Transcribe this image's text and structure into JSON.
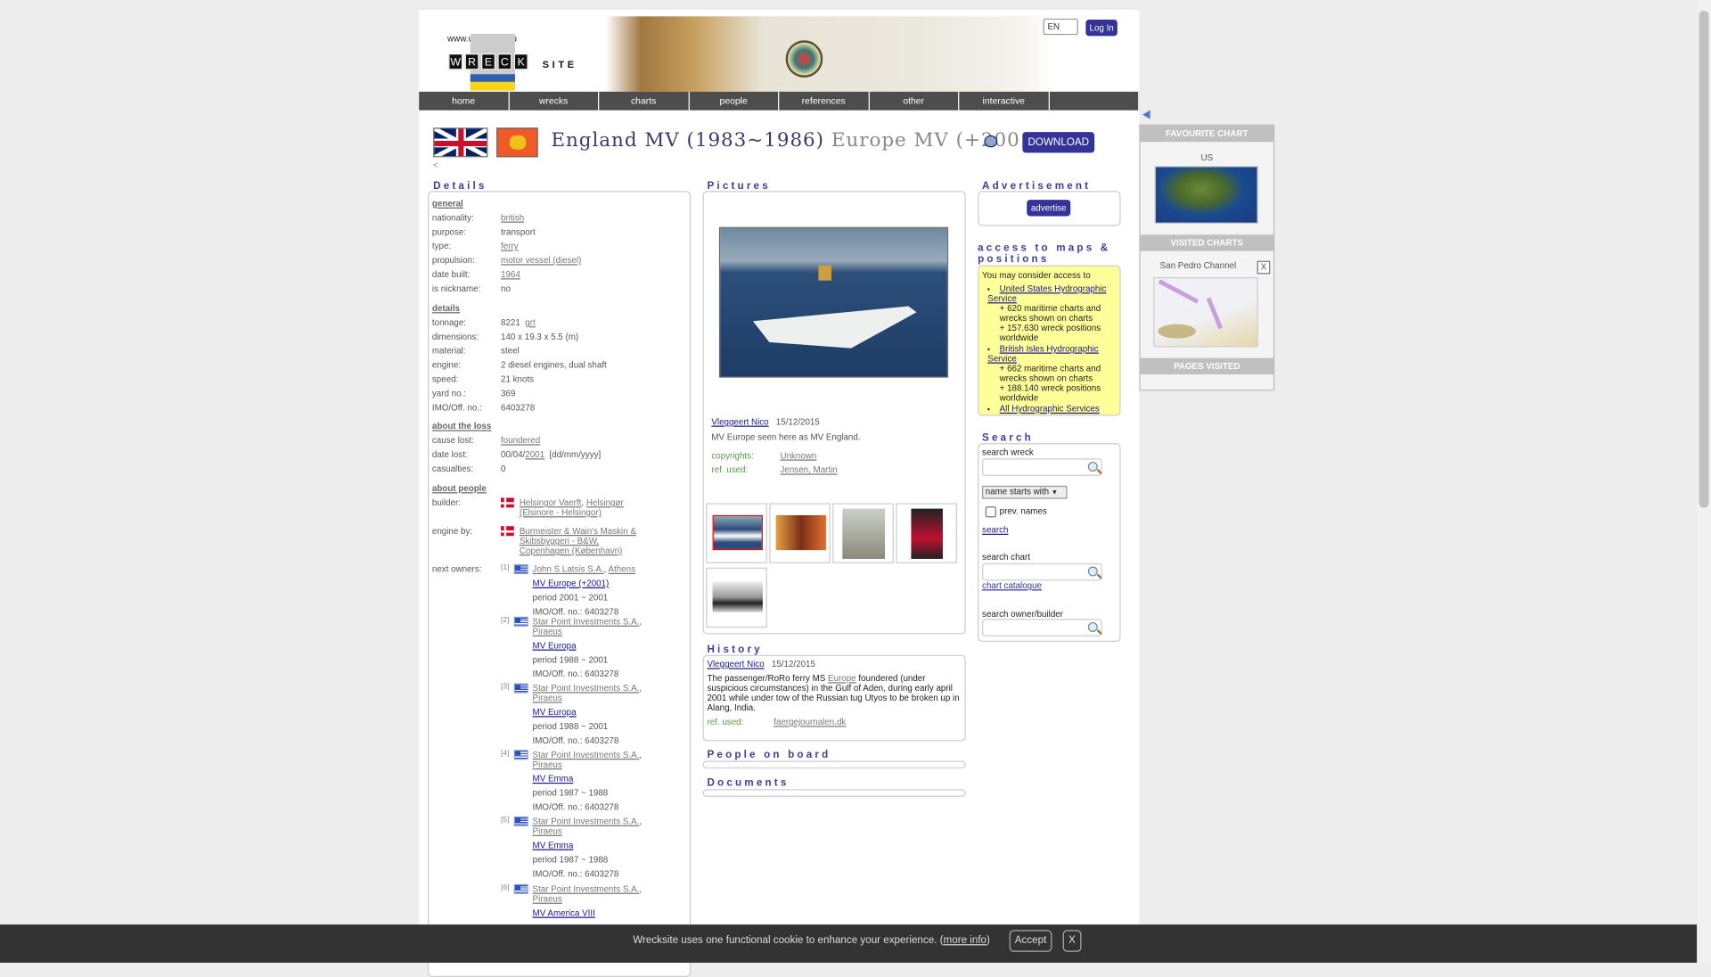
{
  "header": {
    "logo_url_text": "www.wrecksite.eu",
    "logo_letters": [
      "W",
      "R",
      "E",
      "C",
      "K"
    ],
    "logo_site": "SITE",
    "language": "EN",
    "login_label": "Log In"
  },
  "nav": [
    "home",
    "wrecks",
    "charts",
    "people",
    "references",
    "other",
    "interactive",
    ""
  ],
  "title": {
    "main": "England MV (1983~1986)",
    "secondary": "Europe MV (+2001)",
    "download_label": "DOWNLOAD",
    "back": "<"
  },
  "details": {
    "header": "Details",
    "general_label": "general",
    "general": [
      {
        "label": "nationality:",
        "value": "british",
        "link": true
      },
      {
        "label": "purpose:",
        "value": "transport"
      },
      {
        "label": "type:",
        "value": "ferry",
        "link": true
      },
      {
        "label": "propulsion:",
        "value": "motor vessel (diesel)",
        "link": true
      },
      {
        "label": "date built:",
        "value": "1964",
        "link": true
      },
      {
        "label": "is nickname:",
        "value": "no"
      }
    ],
    "details_label": "details",
    "tonnage_label": "tonnage:",
    "tonnage": "8221",
    "tonnage_unit": "grt",
    "details": [
      {
        "label": "dimensions:",
        "value": "140 x 19.3 x 5.5 (m)"
      },
      {
        "label": "material:",
        "value": "steel"
      },
      {
        "label": "engine:",
        "value": "2 diesel engines, dual shaft"
      },
      {
        "label": "speed:",
        "value": "21  knots"
      },
      {
        "label": "yard no.:",
        "value": "369"
      },
      {
        "label": "IMO/Off. no.:",
        "value": "6403278"
      }
    ],
    "loss_label": "about the loss",
    "cause_label": "cause lost:",
    "cause": "foundered",
    "date_lost_label": "date lost:",
    "date_lost_prefix": "00/04/",
    "date_lost_year": "2001",
    "date_format": "[dd/mm/yyyy]",
    "casualties_label": "casualties:",
    "casualties": "0",
    "people_label": "about people",
    "builder_label": "builder:",
    "builder_1": "Helsingor Vaerft",
    "builder_2": "Helsingør (Elsinore - Helsingor)",
    "engine_label": "engine by:",
    "engine_by": "Burmeister & Wain's Maskin & Skibsbyggeri - B&W, Copenhagen (København)",
    "owners_label": "next owners:",
    "owners": [
      {
        "num": "[1]",
        "company": "John S Latsis S.A.",
        "place": "Athens",
        "ship": "MV Europe (+2001)",
        "period": "period 2001 ~ 2001",
        "imo": "IMO/Off. no.: 6403278"
      },
      {
        "num": "[2]",
        "company": "Star Point Investments S.A.",
        "place": "Piraeus",
        "ship": "MV Europa",
        "period": "period 1988 ~ 2001",
        "imo": "IMO/Off. no.: 6403278"
      },
      {
        "num": "[3]",
        "company": "Star Point Investments S.A.",
        "place": "Piraeus",
        "ship": "MV Europa",
        "period": "period 1988 ~ 2001",
        "imo": "IMO/Off. no.: 6403278"
      },
      {
        "num": "[4]",
        "company": "Star Point Investments S.A.",
        "place": "Piraeus",
        "ship": "MV Emma",
        "period": "period 1987 ~ 1988",
        "imo": "IMO/Off. no.: 6403278"
      },
      {
        "num": "[5]",
        "company": "Star Point Investments S.A.",
        "place": "Piraeus",
        "ship": "MV Emma",
        "period": "period 1987 ~ 1988",
        "imo": "IMO/Off. no.: 6403278"
      },
      {
        "num": "[6]",
        "company": "Star Point Investments S.A.",
        "place": "Piraeus",
        "ship": "MV America VIII"
      }
    ]
  },
  "pictures": {
    "header": "Pictures",
    "author": "Vleggeert Nico",
    "date": "15/12/2015",
    "caption": "MV Europe seen here as MV England.",
    "copyrights_label": "copyrights:",
    "copyrights": "Unknown",
    "ref_label": "ref. used:",
    "ref": "Jensen, Martin"
  },
  "history": {
    "header": "History",
    "author": "Vleggeert Nico",
    "date": "15/12/2015",
    "text_1": "The passenger/RoRo ferry MS ",
    "text_link": "Europe",
    "text_2": " foundered (under suspicious circumstances) in the Gulf of Aden, during early april 2001 while under tow of the Russian tug Utyos to be broken up in Alang, India.",
    "ref_label": "ref. used:",
    "ref": "faergejournalen.dk"
  },
  "people_on_board": {
    "header": "People on board"
  },
  "documents": {
    "header": "Documents"
  },
  "advertisement": {
    "header": "Advertisement",
    "button": "advertise"
  },
  "access": {
    "header": "access to maps & positions",
    "intro": "You may consider access to",
    "items": [
      {
        "link": "United States Hydrographic Service",
        "lines": [
          "+ 620 maritime charts and wrecks shown on charts",
          "+ 157.630 wreck positions worldwide"
        ]
      },
      {
        "link": "British Isles Hydrographic Service",
        "lines": [
          "+ 662 maritime charts and wrecks shown on charts",
          "+ 188.140 wreck positions worldwide"
        ]
      },
      {
        "link": "All Hydrographic Services"
      }
    ]
  },
  "search": {
    "header": "Search",
    "wreck_label": "search wreck",
    "mode": "name starts with",
    "prev_names": "prev. names",
    "search_link": "search",
    "chart_label": "search chart",
    "chart_catalogue": "chart catalogue",
    "owner_label": "search owner/builder"
  },
  "sidebar": {
    "favourite_header": "FAVOURITE CHART",
    "favourite_name": "US",
    "visited_header": "VISITED CHARTS",
    "visited_name": "San Pedro Channel",
    "close": "X",
    "pages_header": "PAGES VISITED"
  },
  "cookie": {
    "text": "Wrecksite uses one functional cookie to enhance your experience. (",
    "more": "more info",
    "close_paren": ")",
    "accept": "Accept",
    "close": "X"
  }
}
